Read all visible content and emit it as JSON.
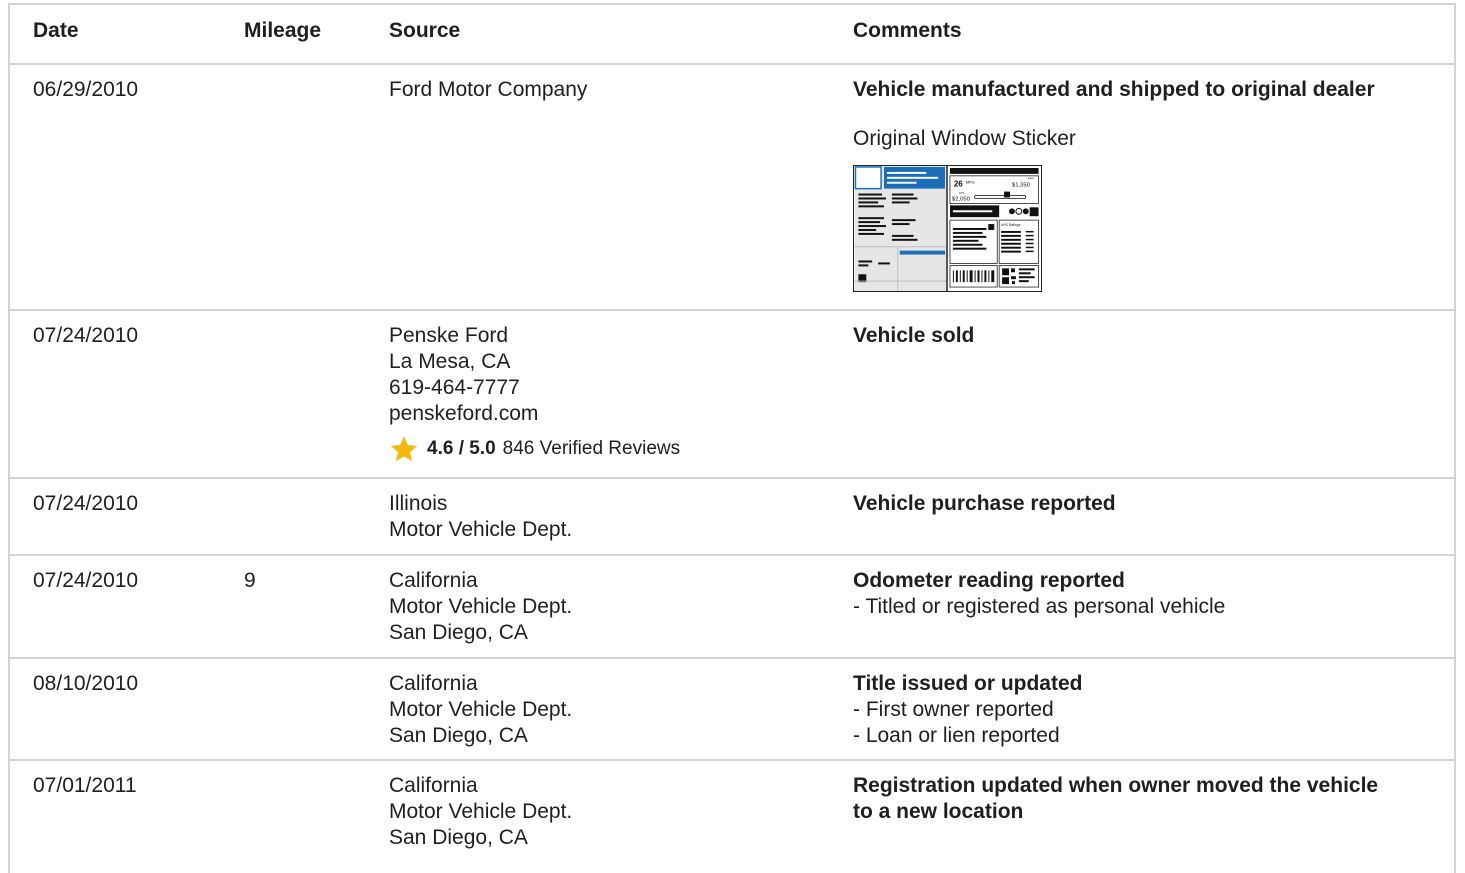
{
  "table": {
    "headers": {
      "date": "Date",
      "mileage": "Mileage",
      "source": "Source",
      "comments": "Comments"
    },
    "rows": [
      {
        "date": "06/29/2010",
        "mileage": "",
        "source": [
          "Ford Motor Company"
        ],
        "comment_title": "Vehicle manufactured and shipped to original dealer",
        "comment_lines": [],
        "sticker_label": "Original Window Sticker",
        "sticker": {
          "mpg": "26",
          "mpg_unit": "MPG",
          "save": "$1,350",
          "save_label": "save",
          "cost": "$2,050",
          "cost_label": "cost",
          "ratings_label": "IIHS Ratings"
        }
      },
      {
        "date": "07/24/2010",
        "mileage": "",
        "source": [
          "Penske Ford",
          "La Mesa, CA",
          "619-464-7777",
          "penskeford.com"
        ],
        "rating": {
          "score": "4.6 / 5.0",
          "reviews": "846 Verified Reviews"
        },
        "comment_title": "Vehicle sold",
        "comment_lines": []
      },
      {
        "date": "07/24/2010",
        "mileage": "",
        "source": [
          "Illinois",
          "Motor Vehicle Dept."
        ],
        "comment_title": "Vehicle purchase reported",
        "comment_lines": []
      },
      {
        "date": "07/24/2010",
        "mileage": "9",
        "source": [
          "California",
          "Motor Vehicle Dept.",
          "San Diego, CA"
        ],
        "comment_title": "Odometer reading reported",
        "comment_lines": [
          "- Titled or registered as personal vehicle"
        ]
      },
      {
        "date": "08/10/2010",
        "mileage": "",
        "source": [
          "California",
          "Motor Vehicle Dept.",
          "San Diego, CA"
        ],
        "comment_title": "Title issued or updated",
        "comment_lines": [
          "- First owner reported",
          "- Loan or lien reported"
        ]
      },
      {
        "date": "07/01/2011",
        "mileage": "",
        "source": [
          "California",
          "Motor Vehicle Dept.",
          "San Diego, CA"
        ],
        "comment_title_lines": [
          "Registration updated when owner moved the vehicle",
          "to a new location"
        ],
        "comment_lines": []
      }
    ]
  },
  "colors": {
    "border": "#d4d4d4",
    "text": "#1f1f1f",
    "star": "#f5b80f",
    "sticker_blue": "#1b6fb8"
  },
  "icons": {
    "rating": "star-icon"
  }
}
